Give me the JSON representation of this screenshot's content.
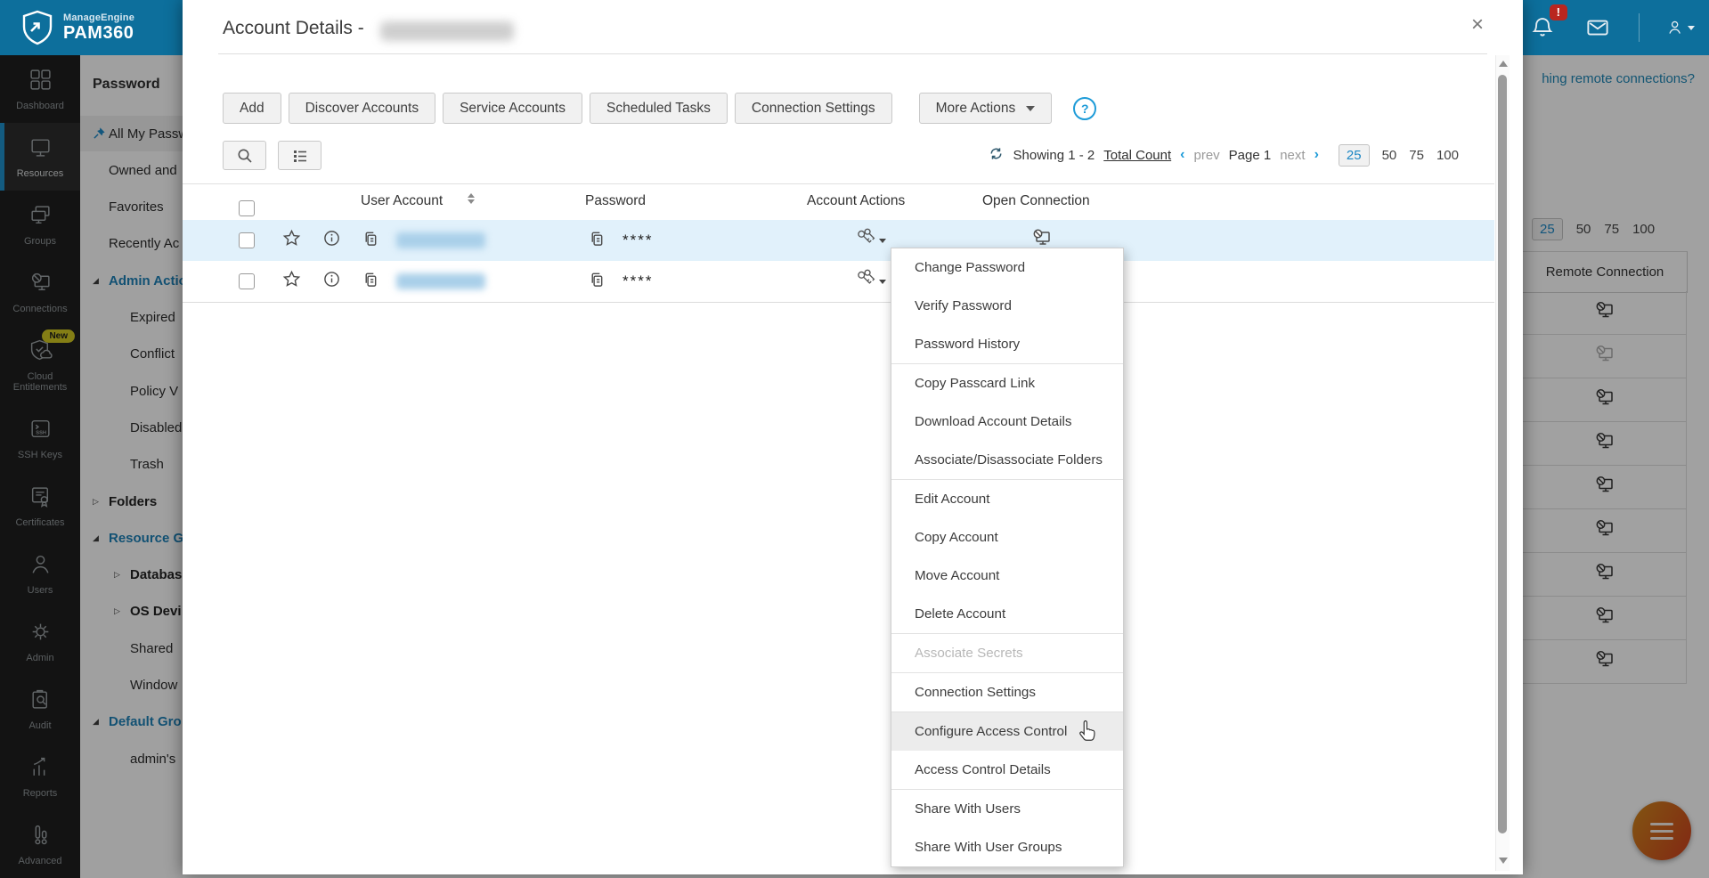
{
  "colors": {
    "topbar_blue": "#0d6f9c",
    "accent_blue": "#1d87c4",
    "rail_dark": "#1f1f1f",
    "row_highlight": "#e1f1fb",
    "badge_red": "#b9261f",
    "new_badge_yellow": "#cfc522",
    "fab_gradient": [
      "#cc851c",
      "#cc4a1e"
    ]
  },
  "brand": {
    "small": "ManageEngine",
    "big": "PAM360"
  },
  "topbar": {
    "notification_badge": "!"
  },
  "sidebar": {
    "new_badge": "New",
    "items": [
      {
        "label": "Dashboard",
        "icon": "dashboard-icon",
        "active": false
      },
      {
        "label": "Resources",
        "icon": "resources-icon",
        "active": true
      },
      {
        "label": "Groups",
        "icon": "groups-icon",
        "active": false
      },
      {
        "label": "Connections",
        "icon": "connections-icon",
        "active": false
      },
      {
        "label": "Cloud Entitlements",
        "icon": "cloud-entitlements-icon",
        "active": false,
        "badge": "New"
      },
      {
        "label": "SSH Keys",
        "icon": "ssh-keys-icon",
        "active": false
      },
      {
        "label": "Certificates",
        "icon": "certificates-icon",
        "active": false
      },
      {
        "label": "Users",
        "icon": "users-icon",
        "active": false
      },
      {
        "label": "Admin",
        "icon": "admin-icon",
        "active": false
      },
      {
        "label": "Audit",
        "icon": "audit-icon",
        "active": false
      },
      {
        "label": "Reports",
        "icon": "reports-icon",
        "active": false
      },
      {
        "label": "Advanced",
        "icon": "advanced-icon",
        "active": false
      }
    ]
  },
  "tree": {
    "title": "Password",
    "items": [
      {
        "label": "All My Passw",
        "style": "selected",
        "pin": true,
        "indent": 0
      },
      {
        "label": "Owned and",
        "style": "plain",
        "indent": 0
      },
      {
        "label": "Favorites",
        "style": "plain",
        "indent": 0
      },
      {
        "label": "Recently Ac",
        "style": "plain",
        "indent": 0
      },
      {
        "label": "Admin Actio",
        "style": "expanded",
        "indent": 0
      },
      {
        "label": "Expired",
        "style": "plain",
        "indent": 1
      },
      {
        "label": "Conflict",
        "style": "plain",
        "indent": 1
      },
      {
        "label": "Policy V",
        "style": "plain",
        "indent": 1
      },
      {
        "label": "Disabled",
        "style": "plain",
        "indent": 1
      },
      {
        "label": "Trash",
        "style": "plain",
        "indent": 1
      },
      {
        "label": "Folders",
        "style": "collapsed",
        "indent": 0
      },
      {
        "label": "Resource G",
        "style": "expanded",
        "indent": 0
      },
      {
        "label": "Databas",
        "style": "collapsed",
        "indent": 1
      },
      {
        "label": "OS Devi",
        "style": "collapsed",
        "indent": 1
      },
      {
        "label": "Shared",
        "style": "plain",
        "indent": 1
      },
      {
        "label": "Window",
        "style": "plain",
        "indent": 1
      },
      {
        "label": "Default Gro",
        "style": "expanded",
        "indent": 0
      },
      {
        "label": "admin's",
        "style": "plain",
        "indent": 1
      }
    ]
  },
  "modal": {
    "title": "Account Details -",
    "close_symbol": "×",
    "toolbar": [
      "Add",
      "Discover Accounts",
      "Service Accounts",
      "Scheduled Tasks",
      "Connection Settings"
    ],
    "more_actions": "More Actions",
    "help_symbol": "?",
    "pagination": {
      "showing": "Showing 1 - 2",
      "total_count": "Total Count",
      "prev_arrow": "‹",
      "prev": "prev",
      "page": "Page 1",
      "next": "next",
      "next_arrow": "›",
      "sizes": [
        "25",
        "50",
        "75",
        "100"
      ],
      "active_size": "25"
    },
    "table": {
      "headers": [
        "User Account",
        "Password",
        "Account Actions",
        "Open Connection"
      ],
      "rows": [
        {
          "password_mask": "****",
          "highlighted": true,
          "open_connection_icon": true
        },
        {
          "password_mask": "****",
          "highlighted": false,
          "open_connection_icon": false
        }
      ]
    }
  },
  "menu": {
    "groups": [
      [
        "Change Password",
        "Verify Password",
        "Password History"
      ],
      [
        "Copy Passcard Link",
        "Download Account Details",
        "Associate/Disassociate Folders"
      ],
      [
        "Edit Account",
        "Copy Account",
        "Move Account",
        "Delete Account"
      ],
      [
        "Associate Secrets"
      ],
      [
        "Connection Settings"
      ],
      [
        "Configure Access Control",
        "Access Control Details"
      ],
      [
        "Share With Users",
        "Share With User Groups"
      ]
    ],
    "disabled_item": "Associate Secrets",
    "hovered_item": "Configure Access Control"
  },
  "background_right": {
    "link": "hing remote connections?",
    "sizes": [
      "25",
      "50",
      "75",
      "100"
    ],
    "active_size": "25",
    "column_header": "Remote Connection",
    "row_icons": [
      "enabled",
      "disabled",
      "enabled",
      "enabled",
      "enabled",
      "enabled",
      "enabled",
      "enabled",
      "enabled"
    ]
  }
}
